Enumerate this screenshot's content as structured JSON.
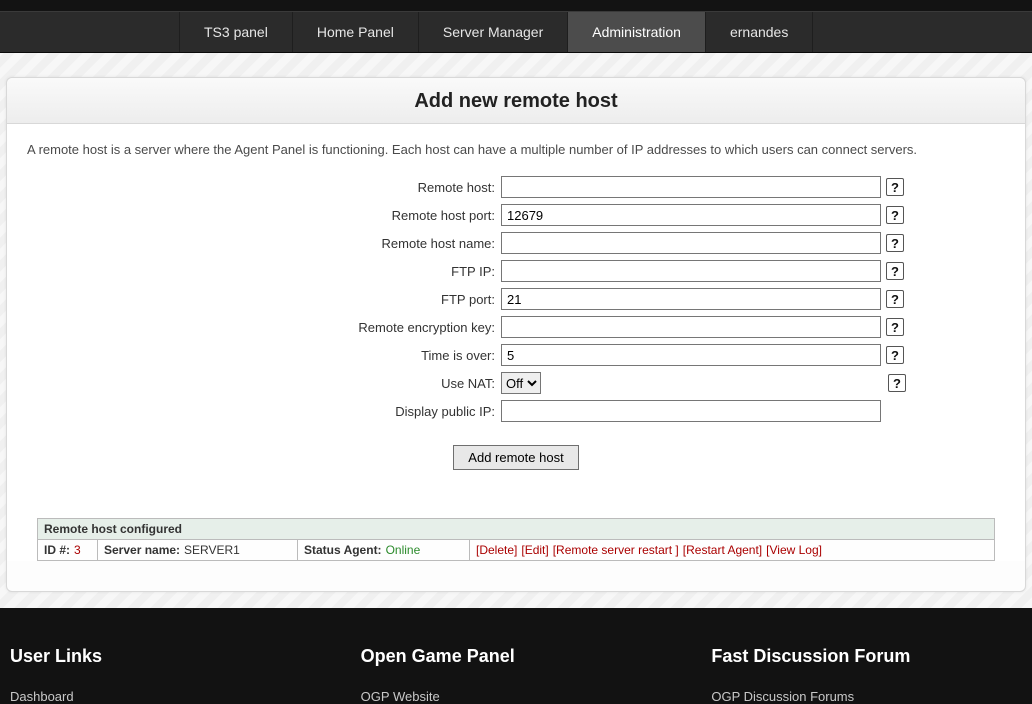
{
  "nav": {
    "items": [
      {
        "label": "TS3 panel"
      },
      {
        "label": "Home Panel"
      },
      {
        "label": "Server Manager"
      },
      {
        "label": "Administration",
        "active": true
      },
      {
        "label": "ernandes"
      }
    ]
  },
  "page": {
    "title": "Add new remote host",
    "intro": "A remote host is a server where the Agent Panel is functioning. Each host can have a multiple number of IP addresses to which users can connect servers."
  },
  "form": {
    "remote_host": {
      "label": "Remote host:",
      "value": ""
    },
    "remote_host_port": {
      "label": "Remote host port:",
      "value": "12679"
    },
    "remote_host_name": {
      "label": "Remote host name:",
      "value": ""
    },
    "ftp_ip": {
      "label": "FTP IP:",
      "value": ""
    },
    "ftp_port": {
      "label": "FTP port:",
      "value": "21"
    },
    "encryption_key": {
      "label": "Remote encryption key:",
      "value": ""
    },
    "timeout": {
      "label": "Time is over:",
      "value": "5"
    },
    "use_nat": {
      "label": "Use NAT:",
      "selected": "Off"
    },
    "display_public_ip": {
      "label": "Display public IP:",
      "value": ""
    },
    "submit_label": "Add remote host",
    "help_tooltip": "?"
  },
  "table": {
    "caption": "Remote host configured",
    "id_label": "ID #:",
    "id_value": "3",
    "name_label": "Server name:",
    "name_value": "SERVER1",
    "status_label": "Status Agent:",
    "status_value": "Online",
    "actions": {
      "delete": "[Delete]",
      "edit": "[Edit]",
      "restart_server": "[Remote server restart ]",
      "restart_agent": "[Restart Agent]",
      "view_log": "[View Log]"
    }
  },
  "footer": {
    "col1": {
      "title": "User Links",
      "link1": "Dashboard"
    },
    "col2": {
      "title": "Open Game Panel",
      "link1": "OGP Website"
    },
    "col3": {
      "title": "Fast Discussion Forum",
      "link1": "OGP Discussion Forums"
    }
  }
}
